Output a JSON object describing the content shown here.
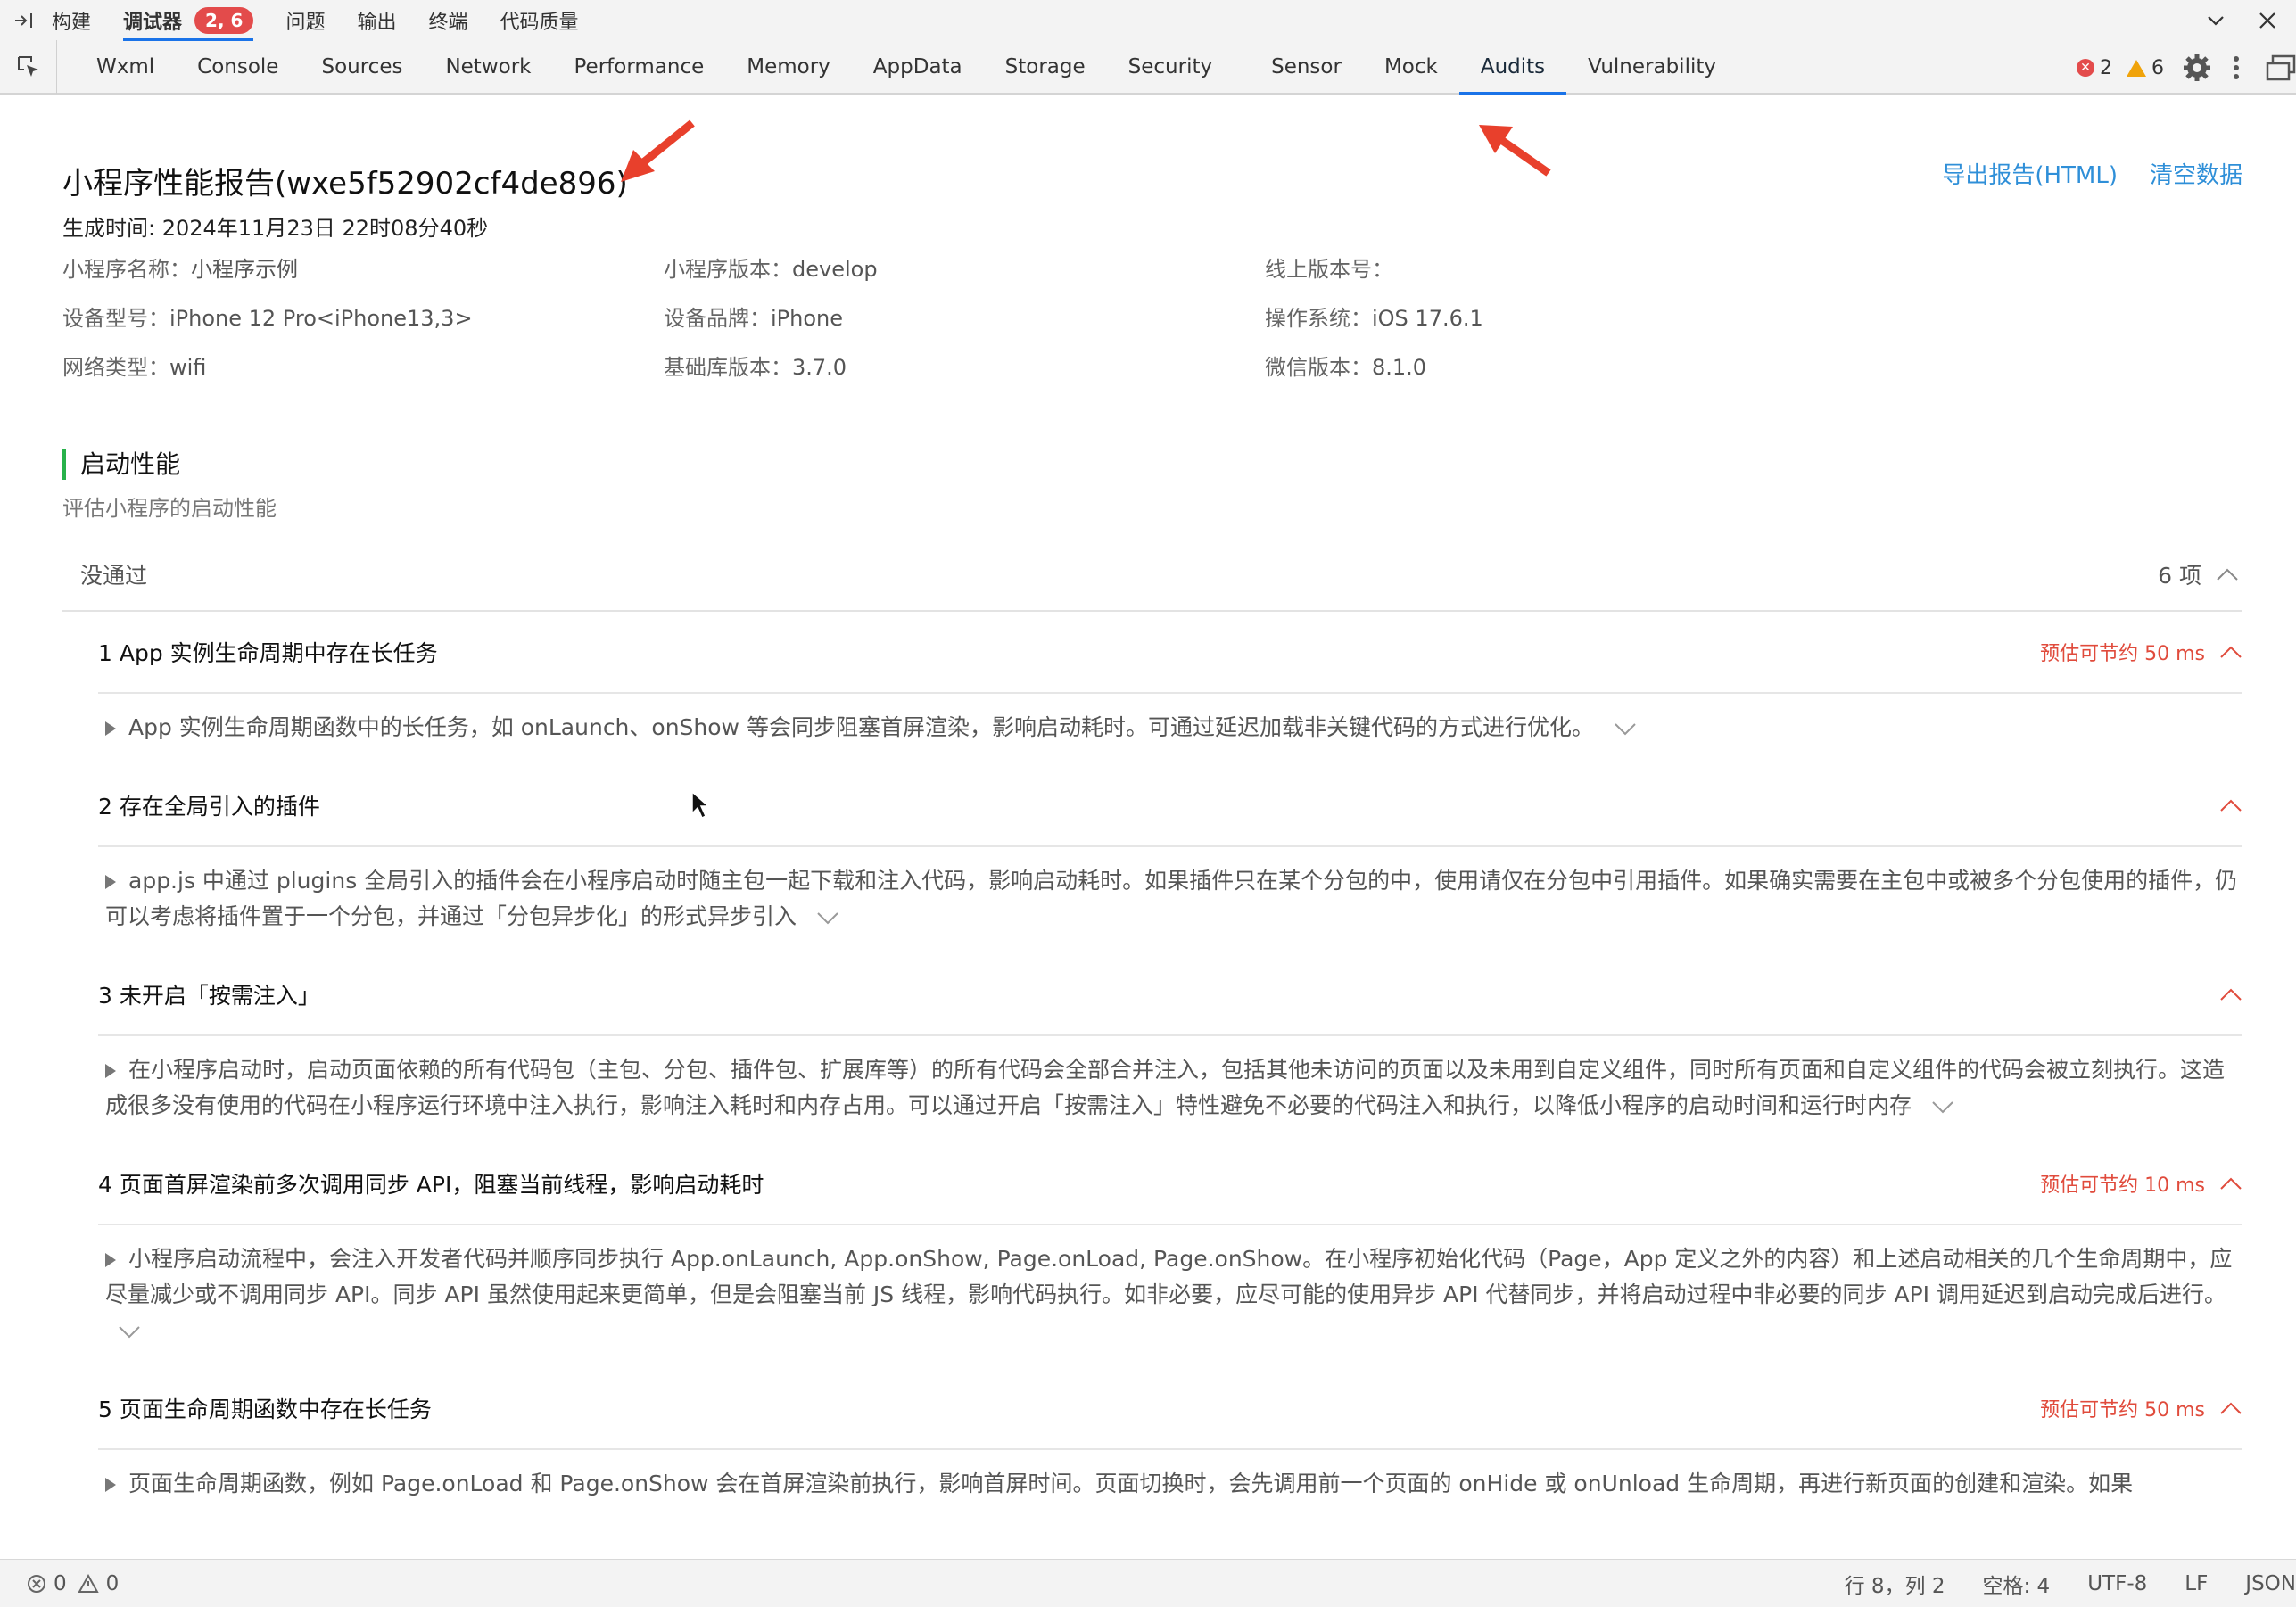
{
  "panel_tabs": [
    {
      "label": "构建",
      "active": false
    },
    {
      "label": "调试器",
      "active": true,
      "badge": "2, 6"
    },
    {
      "label": "问题",
      "active": false
    },
    {
      "label": "输出",
      "active": false
    },
    {
      "label": "终端",
      "active": false
    },
    {
      "label": "代码质量",
      "active": false
    }
  ],
  "tool_tabs": [
    "Wxml",
    "Console",
    "Sources",
    "Network",
    "Performance",
    "Memory",
    "AppData",
    "Storage",
    "Security",
    "Sensor",
    "Mock",
    "Audits",
    "Vulnerability"
  ],
  "active_tool_tab": "Audits",
  "counts": {
    "errors": "2",
    "warnings": "6"
  },
  "report": {
    "title": "小程序性能报告(wxe5f52902cf4de896)",
    "export_label": "导出报告(HTML)",
    "clear_label": "清空数据",
    "gen_time": "生成时间: 2024年11月23日 22时08分40秒",
    "meta": [
      {
        "k": "小程序名称：",
        "v": "小程序示例"
      },
      {
        "k": "小程序版本：",
        "v": "develop"
      },
      {
        "k": "线上版本号：",
        "v": ""
      },
      {
        "k": "设备型号：",
        "v": "iPhone 12 Pro<iPhone13,3>"
      },
      {
        "k": "设备品牌：",
        "v": "iPhone"
      },
      {
        "k": "操作系统：",
        "v": "iOS 17.6.1"
      },
      {
        "k": "网络类型：",
        "v": "wifi"
      },
      {
        "k": "基础库版本：",
        "v": "3.7.0"
      },
      {
        "k": "微信版本：",
        "v": "8.1.0"
      }
    ],
    "section_title": "启动性能",
    "section_sub": "评估小程序的启动性能",
    "group_label": "没通过",
    "group_count": "6 项",
    "items": [
      {
        "name": "1 App 实例生命周期中存在长任务",
        "save": "预估可节约 50 ms",
        "body": "App 实例生命周期函数中的长任务，如 onLaunch、onShow 等会同步阻塞首屏渲染，影响启动耗时。可通过延迟加载非关键代码的方式进行优化。"
      },
      {
        "name": "2 存在全局引入的插件",
        "save": "",
        "body": "app.js 中通过 plugins 全局引入的插件会在小程序启动时随主包一起下载和注入代码，影响启动耗时。如果插件只在某个分包的中，使用请仅在分包中引用插件。如果确实需要在主包中或被多个分包使用的插件，仍可以考虑将插件置于一个分包，并通过「分包异步化」的形式异步引入"
      },
      {
        "name": "3 未开启「按需注入」",
        "save": "",
        "body": "在小程序启动时，启动页面依赖的所有代码包（主包、分包、插件包、扩展库等）的所有代码会全部合并注入，包括其他未访问的页面以及未用到自定义组件，同时所有页面和自定义组件的代码会被立刻执行。这造成很多没有使用的代码在小程序运行环境中注入执行，影响注入耗时和内存占用。可以通过开启「按需注入」特性避免不必要的代码注入和执行，以降低小程序的启动时间和运行时内存"
      },
      {
        "name": "4 页面首屏渲染前多次调用同步 API，阻塞当前线程，影响启动耗时",
        "save": "预估可节约 10 ms",
        "body": "小程序启动流程中，会注入开发者代码并顺序同步执行 App.onLaunch, App.onShow, Page.onLoad, Page.onShow。在小程序初始化代码（Page，App 定义之外的内容）和上述启动相关的几个生命周期中，应尽量减少或不调用同步 API。同步 API 虽然使用起来更简单，但是会阻塞当前 JS 线程，影响代码执行。如非必要，应尽可能的使用异步 API 代替同步，并将启动过程中非必要的同步 API 调用延迟到启动完成后进行。"
      },
      {
        "name": "5 页面生命周期函数中存在长任务",
        "save": "预估可节约 50 ms",
        "body": "页面生命周期函数，例如 Page.onLoad 和 Page.onShow 会在首屏渲染前执行，影响首屏时间。页面切换时，会先调用前一个页面的 onHide 或 onUnload 生命周期，再进行新页面的创建和渲染。如果"
      }
    ]
  },
  "status": {
    "errors": "0",
    "warnings": "0",
    "position": "行 8，列 2",
    "spaces": "空格: 4",
    "encoding": "UTF-8",
    "eol": "LF",
    "language": "JSON"
  },
  "colors": {
    "accent": "#1a73e8",
    "error": "#e34b4b",
    "warning": "#f0a30a",
    "save": "#e04b3c",
    "section_marker": "#28b24b",
    "link": "#2f8fd8"
  }
}
